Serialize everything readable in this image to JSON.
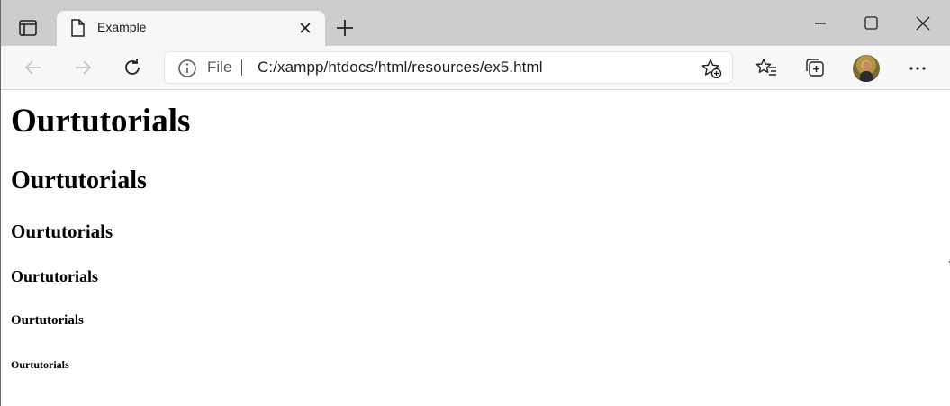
{
  "tab": {
    "title": "Example"
  },
  "address": {
    "scheme_label": "File",
    "url": "C:/xampp/htdocs/html/resources/ex5.html"
  },
  "page": {
    "h1": "Ourtutorials",
    "h2": "Ourtutorials",
    "h3": "Ourtutorials",
    "h4": "Ourtutorials",
    "h5": "Ourtutorials",
    "h6": "Ourtutorials"
  },
  "icons": {
    "tab_actions": "tab-actions-icon",
    "tab_doc": "document-icon",
    "tab_close": "close-icon",
    "new_tab": "plus-icon",
    "minimize": "minimize-icon",
    "maximize": "maximize-icon",
    "close_window": "close-icon",
    "back": "back-arrow-icon",
    "forward": "forward-arrow-icon",
    "refresh": "refresh-icon",
    "info": "info-icon",
    "add_favorite": "star-add-icon",
    "favorites": "favorites-icon",
    "collections": "collections-icon",
    "profile": "avatar",
    "more": "more-icon"
  },
  "colors": {
    "tabstrip": "#cdcdcd",
    "toolbar": "#f7f7f7",
    "text": "#000000"
  }
}
